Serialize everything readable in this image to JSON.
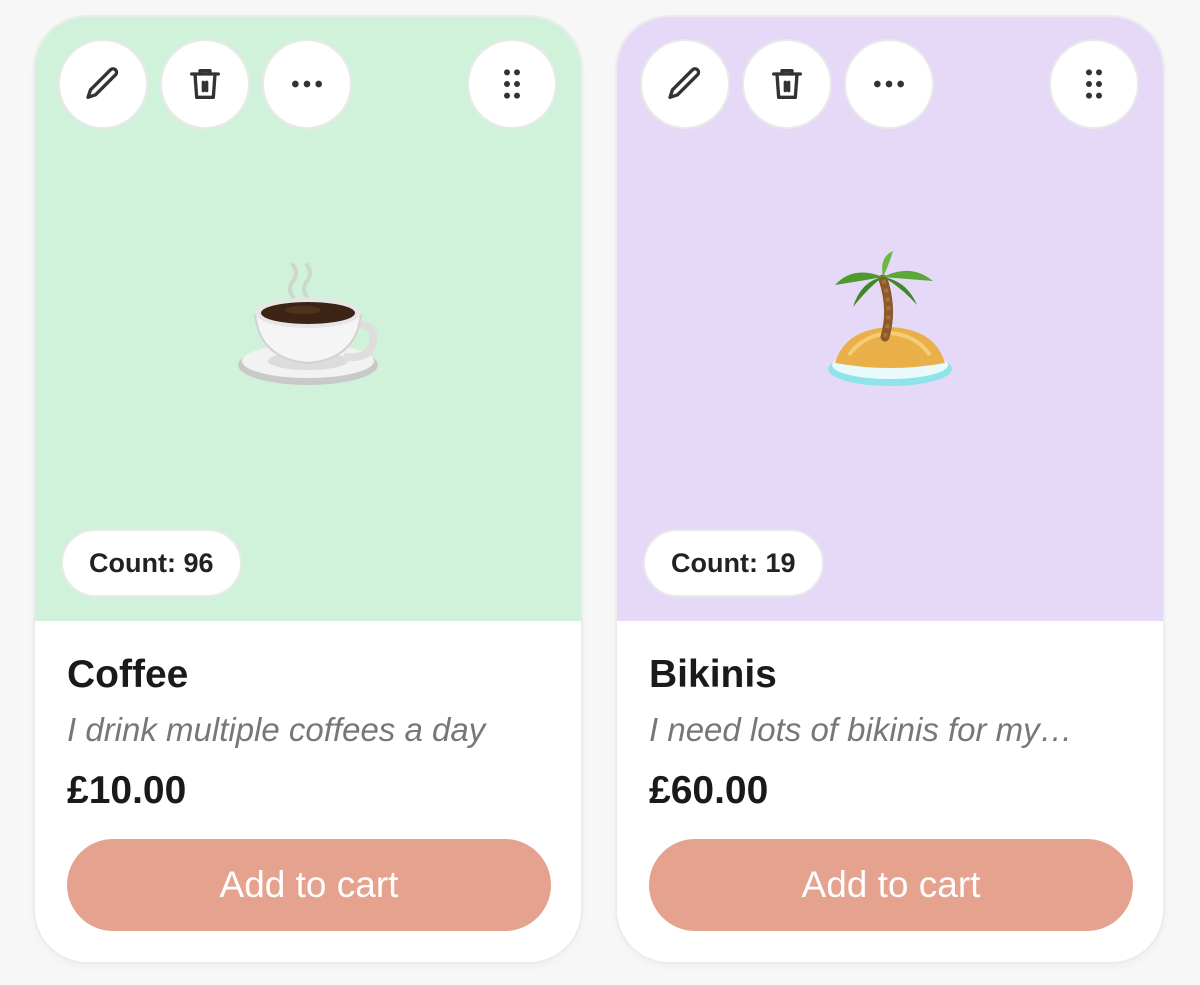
{
  "colors": {
    "coffee_bg": "#d0f2da",
    "bikinis_bg": "#e6d9f8",
    "button_bg": "#e5a28f",
    "button_text": "#ffffff"
  },
  "icons": [
    "pencil-icon",
    "trash-icon",
    "ellipsis-icon",
    "drag-handle-icon",
    "coffee-cup-icon",
    "palm-island-icon"
  ],
  "products": [
    {
      "name": "Coffee",
      "description": "I drink multiple coffees a day",
      "price": "£10.00",
      "count_label": "Count: 96",
      "count": 96,
      "cart_label": "Add to cart",
      "image_icon": "coffee-cup-icon"
    },
    {
      "name": "Bikinis",
      "description": "I need lots of bikinis for my…",
      "price": "£60.00",
      "count_label": "Count: 19",
      "count": 19,
      "cart_label": "Add to cart",
      "image_icon": "palm-island-icon"
    }
  ]
}
